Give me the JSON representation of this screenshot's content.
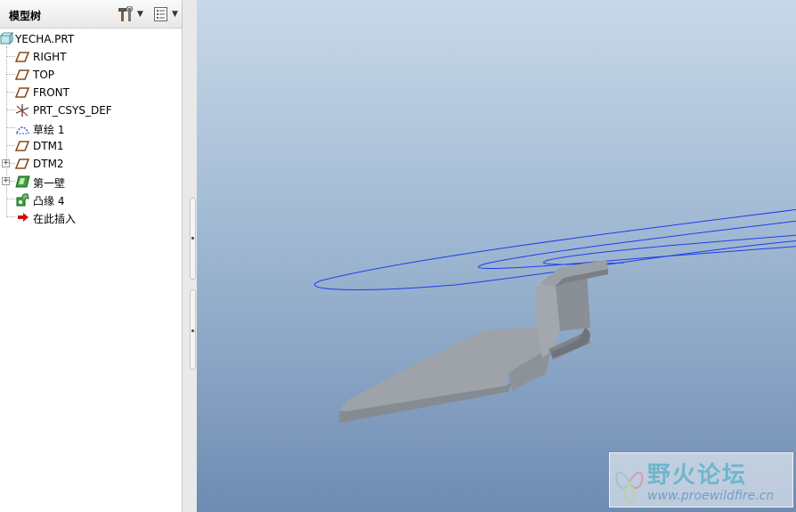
{
  "panel": {
    "title": "模型树",
    "settings_button_icon": "hammer-wrench-icon",
    "show_button_icon": "list-icon"
  },
  "tree": {
    "root": {
      "label": "YECHA.PRT",
      "icon": "part-icon"
    },
    "items": [
      {
        "label": "RIGHT",
        "icon": "datum-plane-icon",
        "expandable": false
      },
      {
        "label": "TOP",
        "icon": "datum-plane-icon",
        "expandable": false
      },
      {
        "label": "FRONT",
        "icon": "datum-plane-icon",
        "expandable": false
      },
      {
        "label": "PRT_CSYS_DEF",
        "icon": "coordinate-system-icon",
        "expandable": false
      },
      {
        "label": "草绘 1",
        "icon": "sketch-icon",
        "expandable": false
      },
      {
        "label": "DTM1",
        "icon": "datum-plane-icon",
        "expandable": false
      },
      {
        "label": "DTM2",
        "icon": "datum-plane-icon",
        "expandable": true
      },
      {
        "label": "第一壁",
        "icon": "sheetmetal-wall-icon",
        "expandable": true
      },
      {
        "label": "凸缘 4",
        "icon": "flange-icon",
        "expandable": false
      },
      {
        "label": "在此插入",
        "icon": "insert-here-arrow-icon",
        "expandable": false
      }
    ]
  },
  "colors": {
    "sketch_curve": "#1e3ee8",
    "part_face": "#9a9fa6",
    "part_edge": "#7b8088",
    "insert_arrow": "#cc1010"
  },
  "watermark": {
    "text": "野火论坛",
    "url": "www.proewildfire.cn"
  }
}
